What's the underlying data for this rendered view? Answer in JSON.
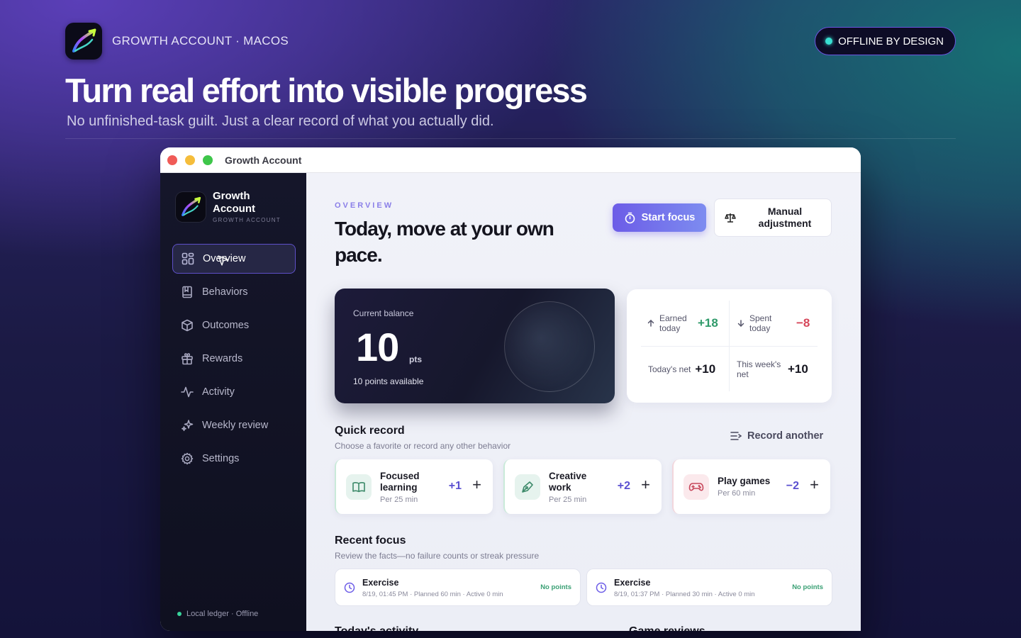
{
  "header": {
    "brand_label": "GROWTH ACCOUNT · MACOS",
    "badge": "OFFLINE BY DESIGN",
    "headline": "Turn real effort into visible progress",
    "subheadline": "No unfinished-task guilt. Just a clear record of what you actually did."
  },
  "window": {
    "title": "Growth Account"
  },
  "sidebar": {
    "app_name": "Growth Account",
    "app_sub": "GROWTH ACCOUNT",
    "items": [
      {
        "label": "Overview",
        "icon": "grid-icon",
        "active": true
      },
      {
        "label": "Behaviors",
        "icon": "book-icon"
      },
      {
        "label": "Outcomes",
        "icon": "cube-icon"
      },
      {
        "label": "Rewards",
        "icon": "gift-icon"
      },
      {
        "label": "Activity",
        "icon": "pulse-icon"
      },
      {
        "label": "Weekly review",
        "icon": "sparkles-icon"
      },
      {
        "label": "Settings",
        "icon": "gear-icon"
      }
    ],
    "footer": "Local ledger · Offline"
  },
  "overview": {
    "eyebrow": "OVERVIEW",
    "title": "Today, move at your own pace.",
    "start_focus": "Start focus",
    "manual_adjustment": "Manual adjustment"
  },
  "balance": {
    "label": "Current balance",
    "value": "10",
    "unit": "pts",
    "available": "10 points available"
  },
  "stats": {
    "earned_label": "Earned today",
    "earned_value": "+18",
    "spent_label": "Spent today",
    "spent_value": "−8",
    "net_label": "Today's net",
    "net_value": "+10",
    "week_label": "This week's net",
    "week_value": "+10"
  },
  "quick_record": {
    "title": "Quick record",
    "subtitle": "Choose a favorite or record any other behavior",
    "record_another": "Record another",
    "items": [
      {
        "name": "Focused learning",
        "per": "Per 25 min",
        "points": "+1",
        "icon": "book-open-icon"
      },
      {
        "name": "Creative work",
        "per": "Per 25 min",
        "points": "+2",
        "icon": "pen-icon"
      },
      {
        "name": "Play games",
        "per": "Per 60 min",
        "points": "−2",
        "icon": "gamepad-icon"
      }
    ]
  },
  "recent_focus": {
    "title": "Recent focus",
    "subtitle": "Review the facts—no failure counts or streak pressure",
    "items": [
      {
        "title": "Exercise",
        "detail": "8/19, 01:45 PM · Planned 60 min · Active 0 min",
        "status": "No points"
      },
      {
        "title": "Exercise",
        "detail": "8/19, 01:37 PM · Planned 30 min · Active 0 min",
        "status": "No points"
      }
    ]
  },
  "bottom_sections": {
    "left": "Today's activity",
    "right": "Game reviews"
  },
  "colors": {
    "accent": "#6c5ce7",
    "positive": "#2f9a6a",
    "negative": "#d6475a",
    "online": "#39e0d2"
  }
}
